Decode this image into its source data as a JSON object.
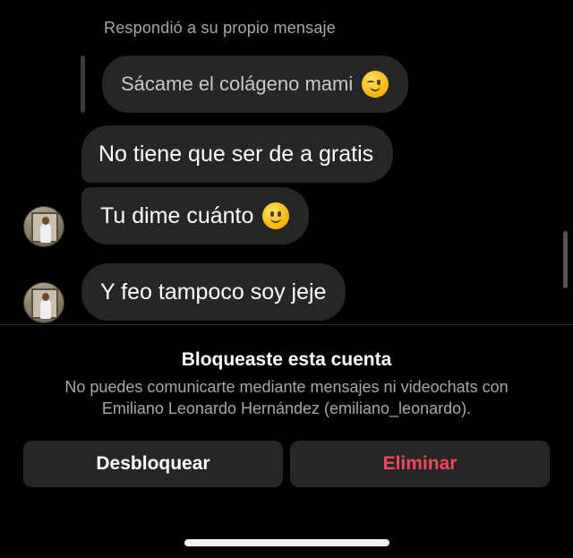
{
  "thread": {
    "reply_note": "Respondió a su propio mensaje",
    "messages": [
      {
        "text": "Sácame el colágeno mami",
        "emoji": "winking-face-emoji",
        "quoted": true
      },
      {
        "text": "No tiene que ser de a gratis"
      },
      {
        "text": "Tu dime cuánto",
        "emoji": "slightly-smiling-face-emoji"
      },
      {
        "text": "Y feo tampoco soy jeje"
      }
    ]
  },
  "blocked_banner": {
    "title": "Bloqueaste esta cuenta",
    "description": "No puedes comunicarte mediante mensajes ni videochats con Emiliano Leonardo Hernández (emiliano_leonardo).",
    "unblock_label": "Desbloquear",
    "delete_label": "Eliminar"
  },
  "colors": {
    "background": "#000000",
    "bubble": "#262628",
    "muted_text": "#a8a8a8",
    "destructive": "#ed4956"
  }
}
